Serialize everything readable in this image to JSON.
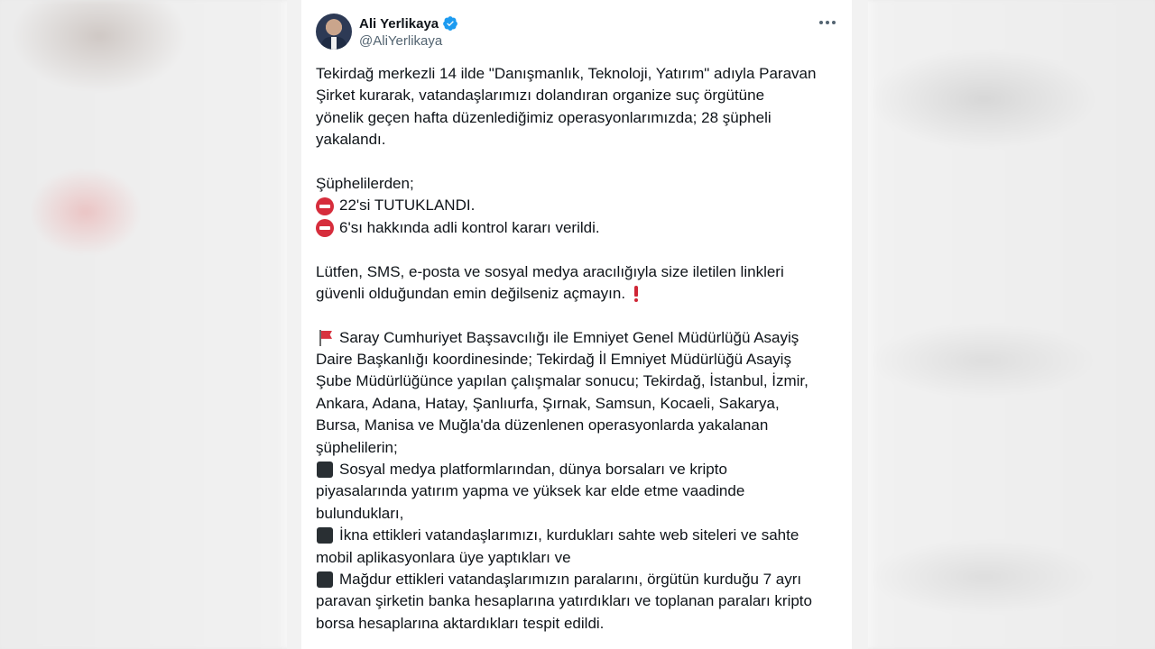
{
  "post": {
    "author_name": "Ali Yerlikaya",
    "author_handle": "@AliYerlikaya",
    "verified_color": "#1d9bf0"
  },
  "body_lines": [
    {
      "icon": "",
      "text": "Tekirdağ merkezli 14 ilde \"Danışmanlık, Teknoloji, Yatırım\" adıyla Paravan"
    },
    {
      "icon": "",
      "text": "Şirket kurarak, vatandaşlarımızı dolandıran organize suç örgütüne"
    },
    {
      "icon": "",
      "text": "yönelik geçen hafta düzenlediğimiz operasyonlarımızda; 28 şüpheli"
    },
    {
      "icon": "",
      "text": "yakalandı."
    },
    {
      "icon": "",
      "text": ""
    },
    {
      "icon": "",
      "text": "Şüphelilerden;"
    },
    {
      "icon": "no-entry-icon",
      "text": "22'si TUTUKLANDI."
    },
    {
      "icon": "no-entry-icon",
      "text": "6'sı hakkında adli kontrol kararı verildi."
    },
    {
      "icon": "",
      "text": ""
    },
    {
      "icon": "",
      "text": "Lütfen, SMS, e-posta ve sosyal medya aracılığıyla size iletilen linkleri"
    },
    {
      "icon": "",
      "text": "güvenli olduğundan emin değilseniz açmayın.",
      "trail_icon": "exclamation-icon"
    },
    {
      "icon": "",
      "text": ""
    },
    {
      "icon": "flag-icon",
      "text": "Saray Cumhuriyet Başsavcılığı ile Emniyet Genel Müdürlüğü Asayiş"
    },
    {
      "icon": "",
      "text": "Daire Başkanlığı koordinesinde; Tekirdağ İl Emniyet Müdürlüğü Asayiş"
    },
    {
      "icon": "",
      "text": "Şube Müdürlüğünce yapılan çalışmalar sonucu; Tekirdağ, İstanbul, İzmir,"
    },
    {
      "icon": "",
      "text": "Ankara, Adana, Hatay, Şanlıurfa, Şırnak, Samsun, Kocaeli, Sakarya,"
    },
    {
      "icon": "",
      "text": "Bursa, Manisa ve Muğla'da düzenlenen operasyonlarda yakalanan"
    },
    {
      "icon": "",
      "text": "şüphelilerin;"
    },
    {
      "icon": "black-square-icon",
      "text": "Sosyal medya platformlarından, dünya borsaları ve kripto"
    },
    {
      "icon": "",
      "text": "piyasalarında yatırım yapma ve yüksek kar elde etme vaadinde"
    },
    {
      "icon": "",
      "text": "bulundukları,"
    },
    {
      "icon": "black-square-icon",
      "text": "İkna ettikleri vatandaşlarımızı, kurdukları sahte web siteleri ve sahte"
    },
    {
      "icon": "",
      "text": "mobil aplikasyonlara üye yaptıkları ve"
    },
    {
      "icon": "black-square-icon",
      "text": "Mağdur ettikleri vatandaşlarımızın paralarını, örgütün kurduğu 7 ayrı"
    },
    {
      "icon": "",
      "text": "paravan şirketin banka hesaplarına yatırdıkları ve toplanan paraları kripto"
    },
    {
      "icon": "",
      "text": "borsa hesaplarına aktardıkları tespit edildi."
    }
  ]
}
